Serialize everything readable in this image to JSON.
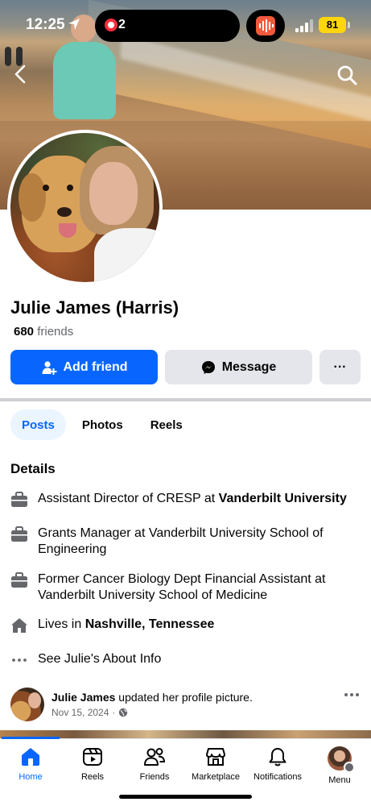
{
  "status_bar": {
    "time": "12:25",
    "recording_count": "2",
    "battery": "81"
  },
  "profile": {
    "name": "Julie James (Harris)",
    "friends_count": "680",
    "friends_label": "friends"
  },
  "actions": {
    "add_friend": "Add friend",
    "message": "Message",
    "more": "···"
  },
  "tabs": [
    {
      "label": "Posts",
      "active": true
    },
    {
      "label": "Photos",
      "active": false
    },
    {
      "label": "Reels",
      "active": false
    }
  ],
  "details": {
    "title": "Details",
    "items": [
      {
        "icon": "briefcase-icon",
        "prefix": "Assistant Director of CRESP at ",
        "bold": "Vanderbilt University"
      },
      {
        "icon": "briefcase-icon",
        "prefix": "Grants Manager at Vanderbilt University School of Engineering",
        "bold": ""
      },
      {
        "icon": "briefcase-icon",
        "prefix": "Former Cancer Biology Dept Financial Assistant at Vanderbilt University School of Medicine",
        "bold": ""
      },
      {
        "icon": "home-icon",
        "prefix": "Lives in ",
        "bold": "Nashville, Tennessee"
      },
      {
        "icon": "more-dots-icon",
        "prefix": "See Julie's About Info",
        "bold": ""
      }
    ]
  },
  "post": {
    "author": "Julie James",
    "action": " updated her profile picture.",
    "date": "Nov 15, 2024",
    "separator": "·"
  },
  "bottom_nav": [
    {
      "label": "Home",
      "icon": "home-icon",
      "active": true
    },
    {
      "label": "Reels",
      "icon": "reels-icon",
      "active": false
    },
    {
      "label": "Friends",
      "icon": "friends-icon",
      "active": false
    },
    {
      "label": "Marketplace",
      "icon": "marketplace-icon",
      "active": false
    },
    {
      "label": "Notifications",
      "icon": "bell-icon",
      "active": false
    },
    {
      "label": "Menu",
      "icon": "profile-avatar",
      "active": false
    }
  ],
  "colors": {
    "accent": "#0866ff",
    "button_secondary": "#e4e6eb",
    "secondary_text": "#65676b",
    "battery": "#ffd60a"
  }
}
